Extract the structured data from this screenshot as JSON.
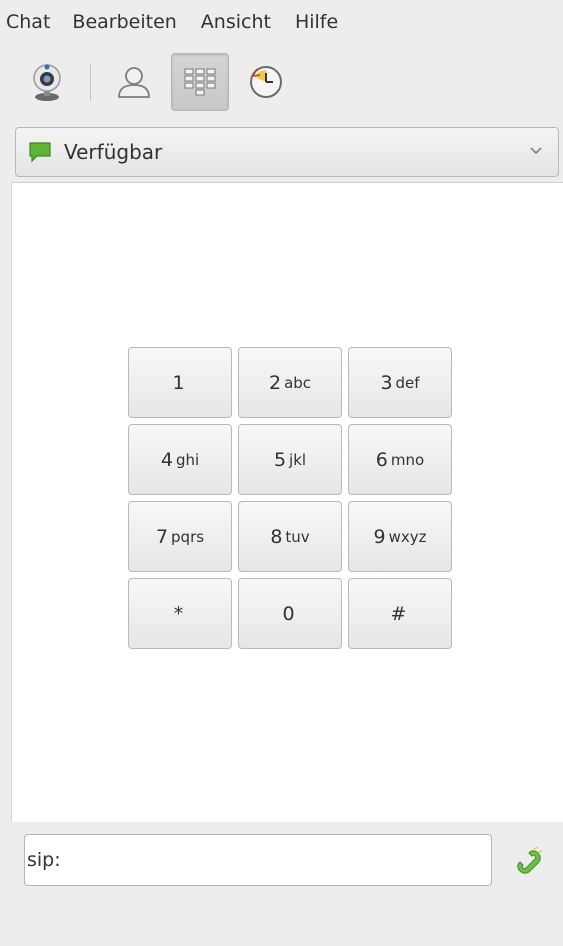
{
  "menubar": {
    "items": [
      {
        "label": "Chat"
      },
      {
        "label": "Bearbeiten"
      },
      {
        "label": "Ansicht"
      },
      {
        "label": "Hilfe"
      }
    ]
  },
  "toolbar": {
    "buttons": [
      {
        "icon": "webcam-icon"
      },
      {
        "icon": "contacts-icon"
      },
      {
        "icon": "dialpad-icon",
        "active": true
      },
      {
        "icon": "call-history-icon"
      }
    ]
  },
  "presence": {
    "label": "Verfügbar",
    "icon": "speech-bubble-icon",
    "color": "#5fb336"
  },
  "dialpad": {
    "keys": [
      {
        "digit": "1",
        "letters": ""
      },
      {
        "digit": "2",
        "letters": "abc"
      },
      {
        "digit": "3",
        "letters": "def"
      },
      {
        "digit": "4",
        "letters": "ghi"
      },
      {
        "digit": "5",
        "letters": "jkl"
      },
      {
        "digit": "6",
        "letters": "mno"
      },
      {
        "digit": "7",
        "letters": "pqrs"
      },
      {
        "digit": "8",
        "letters": "tuv"
      },
      {
        "digit": "9",
        "letters": "wxyz"
      },
      {
        "digit": "*",
        "letters": ""
      },
      {
        "digit": "0",
        "letters": ""
      },
      {
        "digit": "#",
        "letters": ""
      }
    ]
  },
  "call": {
    "input_value": "sip:",
    "button_icon": "phone-call-icon"
  }
}
